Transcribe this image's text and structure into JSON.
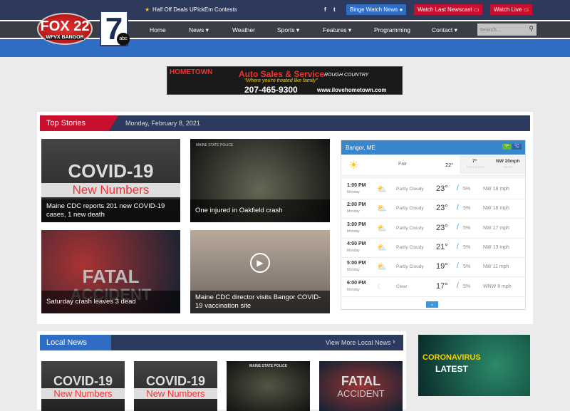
{
  "header": {
    "top_links": [
      "Half Off Deals",
      "UPickEm",
      "Contests"
    ],
    "social": [
      "f",
      "t"
    ],
    "binge": "Binge Watch News",
    "newscast": "Watch Last Newscast",
    "live": "Watch Live",
    "logo_fox": "FOX 22",
    "logo_fox_sub": "WFVX BANGOR",
    "logo_abc": "7",
    "logo_abc_sub": "abc"
  },
  "nav": {
    "items": [
      "Home",
      "News ▾",
      "Weather",
      "Sports ▾",
      "Features ▾",
      "Programming",
      "Contact ▾"
    ],
    "search_placeholder": "Search..."
  },
  "ad": {
    "title": "Auto Sales & Service",
    "brand": "HOMETOWN",
    "tagline": "\"Where you're treated like family\"",
    "phone": "207-465-9300",
    "url": "www.ilovehometown.com",
    "partner": "ROUGH COUNTRY"
  },
  "top_stories": {
    "label": "Top Stories",
    "date": "Monday, February 8, 2021",
    "stories": [
      {
        "image_text": "COVID-19",
        "image_sub": "New Numbers",
        "caption": "Maine CDC reports 201 new COVID-19 cases, 1 new death"
      },
      {
        "image_text": "MAINE STATE POLICE",
        "caption": "One injured in Oakfield crash"
      },
      {
        "image_text": "FATAL",
        "image_sub": "ACCIDENT",
        "caption": "Saturday crash leaves 3 dead"
      },
      {
        "caption": "Maine CDC director visits Bangor COVID-19 vaccination site"
      }
    ]
  },
  "weather": {
    "location": "Bangor, ME",
    "unit_f": "°F",
    "unit_c": "°C",
    "current": {
      "condition": "Fair",
      "temp": "22°",
      "feels": "7°",
      "feels_label": "FEELS LIKE",
      "wind": "NW 20mph",
      "wind_label": "WIND"
    },
    "hourly": [
      {
        "time": "1:00 PM",
        "day": "Monday",
        "cond": "Partly Cloudy",
        "temp": "23°",
        "precip": "5%",
        "wind": "NW 18 mph"
      },
      {
        "time": "2:00 PM",
        "day": "Monday",
        "cond": "Partly Cloudy",
        "temp": "23°",
        "precip": "5%",
        "wind": "NW 18 mph"
      },
      {
        "time": "3:00 PM",
        "day": "Monday",
        "cond": "Partly Cloudy",
        "temp": "23°",
        "precip": "5%",
        "wind": "NW 17 mph"
      },
      {
        "time": "4:00 PM",
        "day": "Monday",
        "cond": "Partly Cloudy",
        "temp": "21°",
        "precip": "5%",
        "wind": "NW 13 mph"
      },
      {
        "time": "5:00 PM",
        "day": "Monday",
        "cond": "Partly Cloudy",
        "temp": "19°",
        "precip": "5%",
        "wind": "NW 11 mph"
      },
      {
        "time": "6:00 PM",
        "day": "Monday",
        "cond": "Clear",
        "temp": "17°",
        "precip": "5%",
        "wind": "WNW 8 mph"
      }
    ]
  },
  "local_news": {
    "label": "Local News",
    "more": "View More Local News",
    "thumbs": [
      {
        "t": "COVID-19",
        "s": "New Numbers"
      },
      {
        "t": "COVID-19",
        "s": "New Numbers"
      },
      {
        "t": "MAINE STATE POLICE",
        "s": ""
      },
      {
        "t": "FATAL",
        "s": "ACCIDENT"
      }
    ]
  },
  "promo": {
    "title": "CORONAVIRUS",
    "sub": "LATEST"
  }
}
